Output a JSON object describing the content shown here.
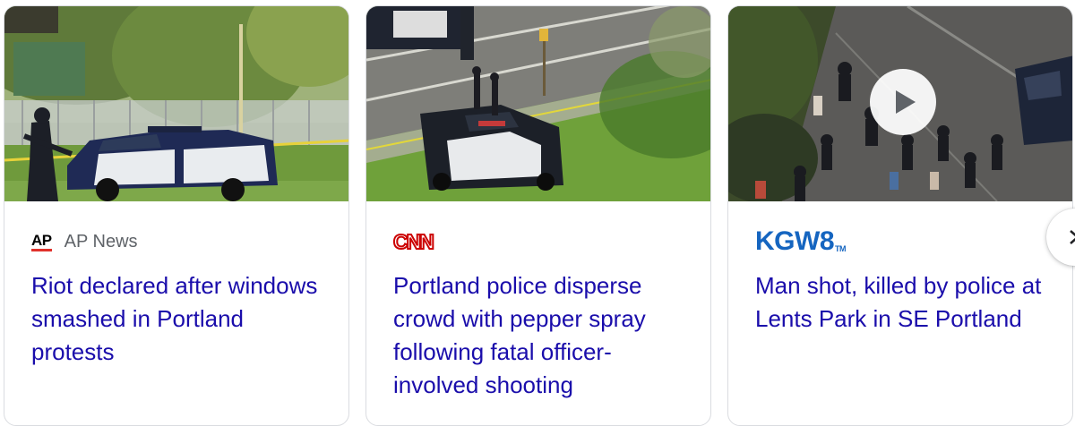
{
  "cards": [
    {
      "source": {
        "logo_text": "AP",
        "name": "AP News"
      },
      "headline": "Riot declared after windows smashed in Portland protests",
      "thumbnail_icon": "police-car-scene-image"
    },
    {
      "source": {
        "logo_text": "CNN",
        "name": ""
      },
      "headline": "Portland police disperse crowd with pepper spray following fatal officer-involved shooting",
      "thumbnail_icon": "aerial-police-car-image"
    },
    {
      "source": {
        "logo_text": "KGW8",
        "logo_suffix": "TM",
        "name": ""
      },
      "headline": "Man shot, killed by police at Lents Park in SE Portland",
      "thumbnail_icon": "crowd-video-thumbnail",
      "has_video": true
    }
  ],
  "controls": {
    "next_icon": "chevron-right-icon"
  },
  "colors": {
    "headline": "#1a0dab",
    "source_name": "#5f6368",
    "ap_red": "#e0312b",
    "cnn_red": "#cc0000",
    "kgw_blue": "#1565c0",
    "card_border": "#dadce0"
  }
}
